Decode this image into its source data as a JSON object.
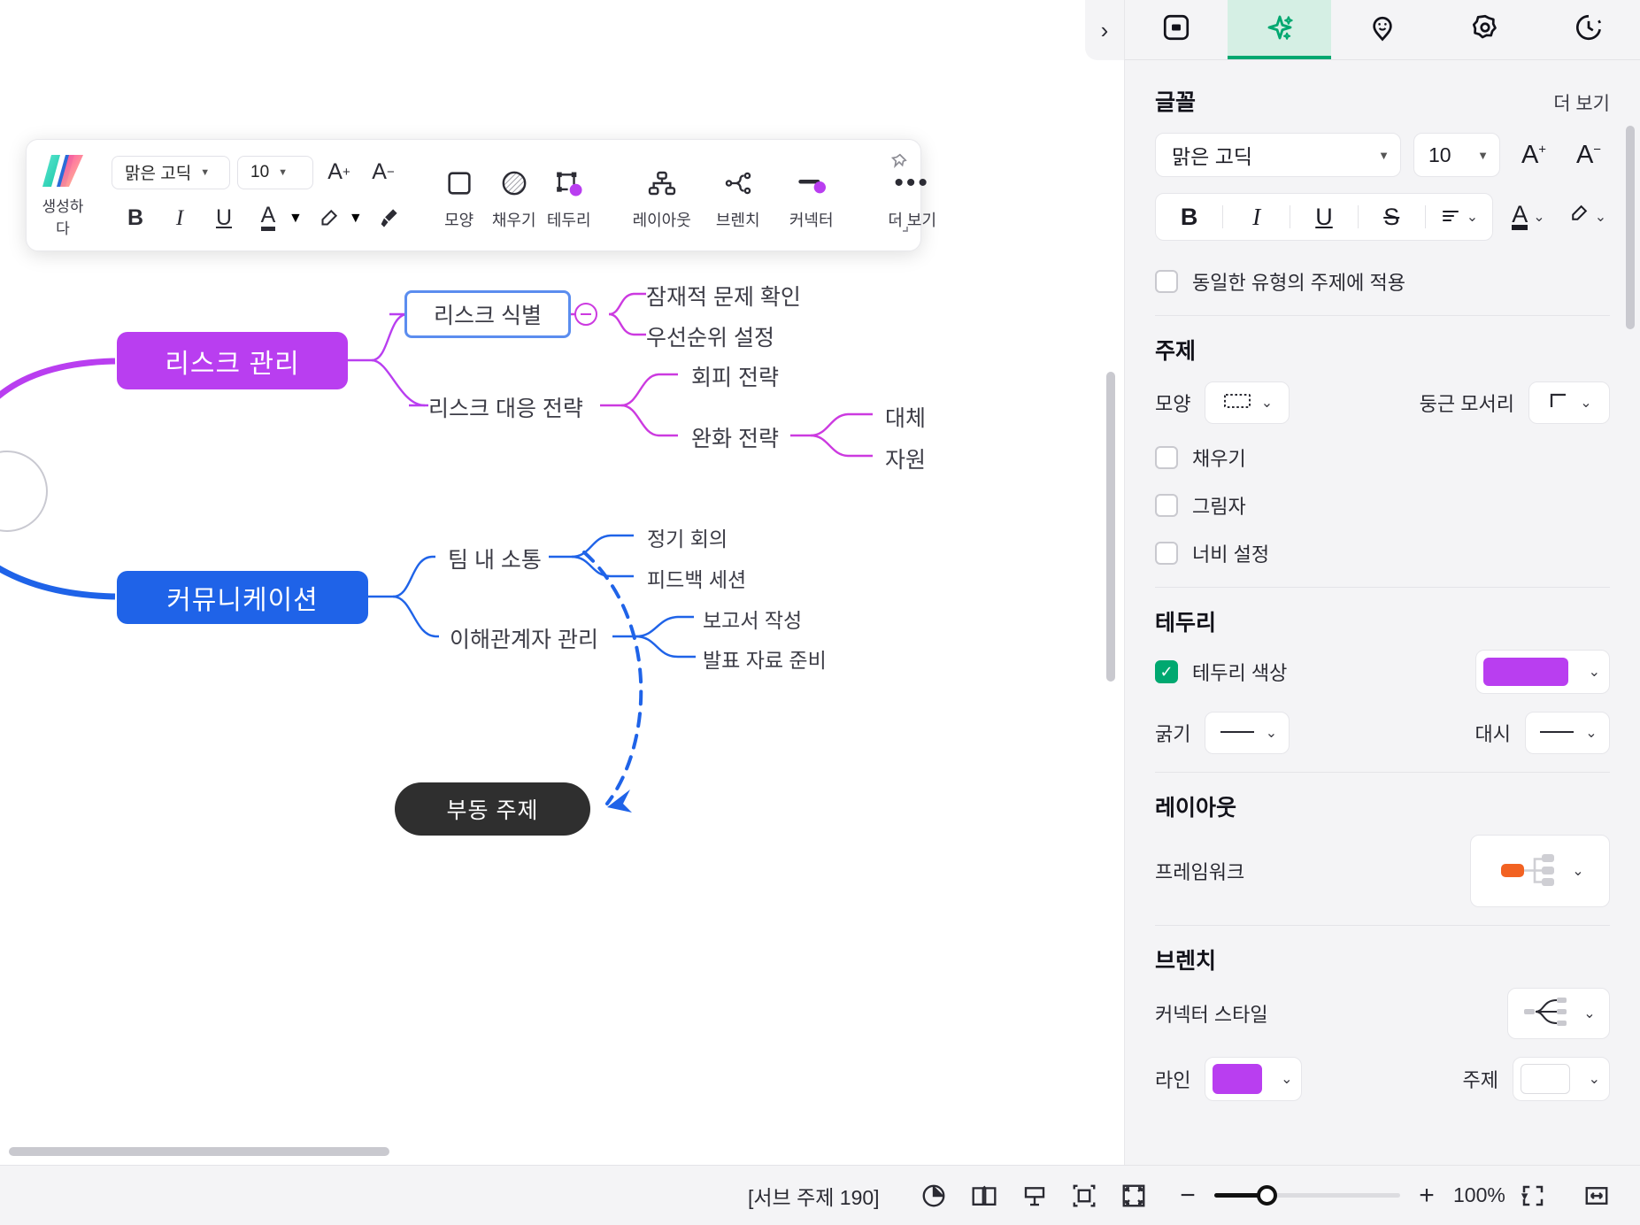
{
  "format_toolbar": {
    "brand_label": "생성하다",
    "brand_icon": "app-logo-icon",
    "font_family": "맑은 고딕",
    "font_size": "10",
    "increase_font": "A",
    "decrease_font": "A",
    "bold": "B",
    "italic": "I",
    "underline": "U",
    "font_color": "A",
    "highlight": "highlighter-icon",
    "format_painter": "format-painter-icon",
    "tools": [
      {
        "label": "모양",
        "icon": "shape-square-icon"
      },
      {
        "label": "채우기",
        "icon": "fill-circle-icon"
      },
      {
        "label": "테두리",
        "icon": "border-icon"
      },
      {
        "label": "레이아웃",
        "icon": "layout-tree-icon"
      },
      {
        "label": "브렌치",
        "icon": "branch-icon"
      },
      {
        "label": "커넥터",
        "icon": "connector-icon"
      }
    ],
    "more_label": "더 보기",
    "more_icon": "ellipsis-icon",
    "pin_icon": "pin-icon",
    "collapse_icon": "collapse-corner-icon"
  },
  "panel_toggle": {
    "icon": "chevron-right-icon"
  },
  "right_panel": {
    "tabs": [
      {
        "name": "style-tab",
        "icon": "square-frame-icon",
        "active": false
      },
      {
        "name": "ai-tab",
        "icon": "sparkle-icon",
        "active": true
      },
      {
        "name": "sticker-tab",
        "icon": "pin-smiley-icon",
        "active": false
      },
      {
        "name": "theme-tab",
        "icon": "flower-icon",
        "active": false
      },
      {
        "name": "history-tab",
        "icon": "clock-history-icon",
        "active": false
      }
    ],
    "font_section": {
      "title": "글꼴",
      "more_label": "더 보기",
      "font_family": "맑은 고딕",
      "font_size": "10",
      "increase_font": "A",
      "decrease_font": "A",
      "bold": "B",
      "italic": "I",
      "underline": "U",
      "strikethrough": "S",
      "align_icon": "align-left-icon",
      "text_color_icon": "text-color-icon",
      "highlight_icon": "highlighter-icon",
      "apply_same_type_label": "동일한 유형의 주제에 적용",
      "apply_same_type_checked": false
    },
    "topic_section": {
      "title": "주제",
      "shape_label": "모양",
      "shape_value_icon": "dotted-rect-icon",
      "corner_label": "둥근 모서리",
      "corner_value_icon": "sharp-corner-icon",
      "fill_label": "채우기",
      "fill_checked": false,
      "shadow_label": "그림자",
      "shadow_checked": false,
      "width_label": "너비 설정",
      "width_checked": false
    },
    "border_section": {
      "title": "테두리",
      "color_label": "테두리 색상",
      "color_checked": true,
      "color_value": "#b93ef0",
      "thickness_label": "굵기",
      "thickness_icon": "solid-line-icon",
      "dash_label": "대시",
      "dash_icon": "solid-line-icon"
    },
    "layout_section": {
      "title": "레이아웃",
      "framework_label": "프레임워크",
      "framework_icon": "tree-layout-icon",
      "framework_color": "#f26222"
    },
    "branch_section": {
      "title": "브렌치",
      "connector_style_label": "커넥터 스타일",
      "connector_style_icon": "curve-connector-icon",
      "line_label": "라인",
      "line_color": "#b93ef0",
      "topic_label": "주제",
      "topic_color": "#ffffff"
    }
  },
  "status_bar": {
    "subtopic_count": "[서브 주제 190]",
    "icons": [
      {
        "name": "mouse-mode-icon"
      },
      {
        "name": "outline-view-icon"
      },
      {
        "name": "presentation-icon"
      },
      {
        "name": "fit-screen-icon"
      },
      {
        "name": "fullscreen-icon"
      }
    ],
    "zoom_out": "−",
    "zoom_in": "+",
    "zoom_value": "100%",
    "zoom_caret": "▾",
    "focus_icon": "focus-brackets-icon",
    "fit_width_icon": "fit-width-icon"
  },
  "mindmap": {
    "nodes": [
      {
        "name": "node-risk-management",
        "label": "리스크 관리",
        "type": "root-purple"
      },
      {
        "name": "node-risk-identify",
        "label": "리스크 식별",
        "type": "selected"
      },
      {
        "name": "node-potential-issue",
        "label": "잠재적 문제 확인",
        "type": "plain"
      },
      {
        "name": "node-priority",
        "label": "우선순위 설정",
        "type": "plain"
      },
      {
        "name": "node-risk-response",
        "label": "리스크 대응 전략",
        "type": "plain"
      },
      {
        "name": "node-avoid-strategy",
        "label": "회피 전략",
        "type": "plain"
      },
      {
        "name": "node-mitigate-strategy",
        "label": "완화 전략",
        "type": "plain"
      },
      {
        "name": "node-alternative",
        "label": "대체",
        "type": "plain"
      },
      {
        "name": "node-resource",
        "label": "자원",
        "type": "plain"
      },
      {
        "name": "node-communication",
        "label": "커뮤니케이션",
        "type": "root-blue"
      },
      {
        "name": "node-team-comm",
        "label": "팀 내 소통",
        "type": "plain"
      },
      {
        "name": "node-regular-meeting",
        "label": "정기 회의",
        "type": "plain"
      },
      {
        "name": "node-feedback-session",
        "label": "피드백 세션",
        "type": "plain"
      },
      {
        "name": "node-stakeholder",
        "label": "이해관계자 관리",
        "type": "plain"
      },
      {
        "name": "node-report-writing",
        "label": "보고서 작성",
        "type": "plain"
      },
      {
        "name": "node-presentation-prep",
        "label": "발표 자료 준비",
        "type": "plain"
      },
      {
        "name": "node-floating-topic",
        "label": "부동 주제",
        "type": "floating"
      }
    ],
    "colors": {
      "purple": "#b93ef0",
      "blue": "#1f63e8",
      "selection": "#5b8def",
      "floating": "#2f2f2f"
    }
  }
}
